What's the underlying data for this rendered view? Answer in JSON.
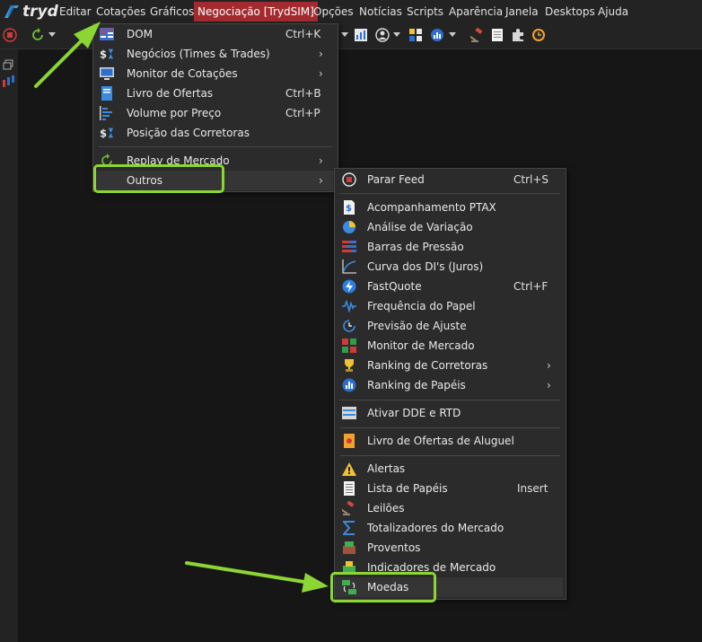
{
  "app": {
    "logo_text": "tryd"
  },
  "menubar": {
    "items": [
      "Editar",
      "Cotações",
      "Gráficos",
      "Negociação [TrydSIM]",
      "Opções",
      "Notícias",
      "Scripts",
      "Aparência",
      "Janela",
      "Desktops",
      "Ajuda"
    ]
  },
  "cotacoes_menu": {
    "items": [
      {
        "label": "DOM",
        "shortcut": "Ctrl+K",
        "icon": "dom-grid-icon"
      },
      {
        "label": "Negócios (Times & Trades)",
        "shortcut": "",
        "icon": "dollar-hourglass-icon",
        "submenu": true
      },
      {
        "label": "Monitor de Cotações",
        "shortcut": "",
        "icon": "monitor-icon",
        "submenu": true
      },
      {
        "label": "Livro de Ofertas",
        "shortcut": "Ctrl+B",
        "icon": "book-icon"
      },
      {
        "label": "Volume por Preço",
        "shortcut": "Ctrl+P",
        "icon": "volume-bars-icon"
      },
      {
        "label": "Posição das Corretoras",
        "shortcut": "",
        "icon": "dollar-hourglass-icon"
      },
      {
        "label": "Replay de Mercado",
        "shortcut": "",
        "icon": "replay-icon",
        "submenu": true
      },
      {
        "label": "Outros",
        "shortcut": "",
        "icon": "",
        "submenu": true
      }
    ]
  },
  "outros_menu": {
    "items": [
      {
        "label": "Parar Feed",
        "shortcut": "Ctrl+S",
        "icon": "stop-icon"
      },
      {
        "label": "Acompanhamento PTAX",
        "shortcut": "",
        "icon": "ptax-doc-icon"
      },
      {
        "label": "Análise de Variação",
        "shortcut": "",
        "icon": "variation-icon"
      },
      {
        "label": "Barras de Pressão",
        "shortcut": "",
        "icon": "pressure-bars-icon"
      },
      {
        "label": "Curva dos DI's (Juros)",
        "shortcut": "",
        "icon": "curve-icon"
      },
      {
        "label": "FastQuote",
        "shortcut": "Ctrl+F",
        "icon": "lightning-icon"
      },
      {
        "label": "Frequência do Papel",
        "shortcut": "",
        "icon": "pulse-icon"
      },
      {
        "label": "Previsão de Ajuste",
        "shortcut": "",
        "icon": "clock-forecast-icon"
      },
      {
        "label": "Monitor de Mercado",
        "shortcut": "",
        "icon": "market-monitor-icon"
      },
      {
        "label": "Ranking de Corretoras",
        "shortcut": "",
        "icon": "trophy-icon",
        "submenu": true
      },
      {
        "label": "Ranking de Papéis",
        "shortcut": "",
        "icon": "ranking-badge-icon",
        "submenu": true
      },
      {
        "label": "Ativar DDE e RTD",
        "shortcut": "",
        "icon": "dde-icon"
      },
      {
        "label": "Livro de Ofertas de Aluguel",
        "shortcut": "",
        "icon": "rental-book-icon"
      },
      {
        "label": "Alertas",
        "shortcut": "",
        "icon": "warning-icon"
      },
      {
        "label": "Lista de Papéis",
        "shortcut": "Insert",
        "icon": "list-doc-icon"
      },
      {
        "label": "Leilões",
        "shortcut": "",
        "icon": "gavel-icon"
      },
      {
        "label": "Totalizadores do Mercado",
        "shortcut": "",
        "icon": "sigma-icon"
      },
      {
        "label": "Proventos",
        "shortcut": "",
        "icon": "proventos-icon"
      },
      {
        "label": "Indicadores de Mercado",
        "shortcut": "",
        "icon": "indicators-icon"
      },
      {
        "label": "Moedas",
        "shortcut": "",
        "icon": "currency-exchange-icon"
      }
    ]
  },
  "submenu_arrow": "›",
  "colors": {
    "active_menu": "#a32b2f",
    "highlight_box": "#8bd633",
    "menu_bg": "#2b2b2b"
  }
}
